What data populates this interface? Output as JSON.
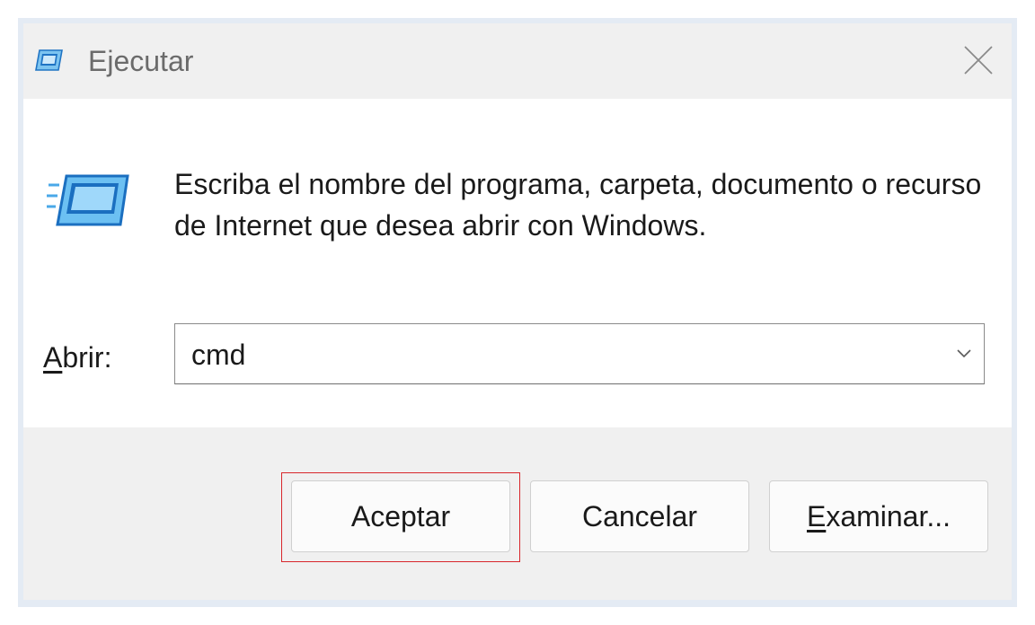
{
  "window": {
    "title": "Ejecutar",
    "app_icon": "run-dialog-icon",
    "close_icon": "close-icon"
  },
  "content": {
    "icon": "run-dialog-icon",
    "message": "Escriba el nombre del programa, carpeta, documento o recurso de Internet que desea abrir con Windows.",
    "open_label_accel": "A",
    "open_label_rest": "brir:",
    "open_value": "cmd",
    "dropdown_icon": "chevron-down-icon"
  },
  "buttons": {
    "ok": "Aceptar",
    "cancel": "Cancelar",
    "browse_accel": "E",
    "browse_rest": "xaminar..."
  },
  "colors": {
    "accent_icon": "#2a8fd8",
    "focus_highlight": "#d8262b"
  }
}
